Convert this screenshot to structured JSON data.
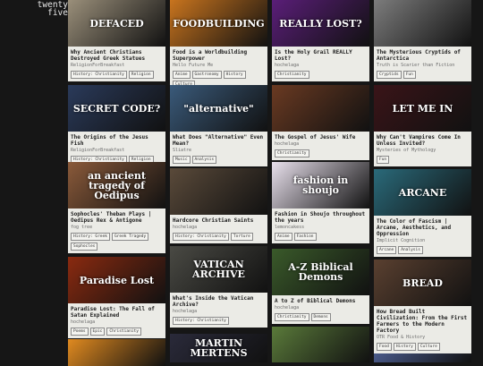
{
  "site": {
    "logo_line1": "twenty",
    "logo_line2": "five"
  },
  "cards": [
    {
      "title": "Why Ancient Christians Destroyed Greek Statues",
      "channel": "ReligionForBreakfast",
      "tags": [
        "History: Christianity",
        "Religion"
      ],
      "thumb_text": "DEFACED",
      "bg": "#9a8f7a"
    },
    {
      "title": "Food is a Worldbuilding Superpower",
      "channel": "Hello Future Me",
      "tags": [
        "Anime",
        "Gastronomy",
        "History",
        "Culture"
      ],
      "thumb_text": "FOODBUILDING",
      "bg": "#c8741e"
    },
    {
      "title": "Is the Holy Grail REALLY Lost?",
      "channel": "hochelaga",
      "tags": [
        "Christianity"
      ],
      "thumb_text": "REALLY LOST?",
      "bg": "#5a1e78"
    },
    {
      "title": "The Mysterious Cryptids of Antarctica",
      "channel": "Truth is Scarier than Fiction",
      "tags": [
        "Cryptids",
        "Fun"
      ],
      "thumb_text": "",
      "bg": "#7c7c7c"
    },
    {
      "title": "The Origins of the Jesus Fish",
      "channel": "ReligionForBreakfast",
      "tags": [
        "History: Christianity",
        "Religion"
      ],
      "thumb_text": "SECRET CODE?",
      "bg": "#2a3a5a"
    },
    {
      "title": "What Does \"Alternative\" Even Mean?",
      "channel": "Sliatre",
      "tags": [
        "Music",
        "Analysis"
      ],
      "thumb_text": "\"alternative\"",
      "bg": "#3a5a7a"
    },
    {
      "title": "The Gospel of Jesus' Wife",
      "channel": "hochelaga",
      "tags": [
        "Christianity"
      ],
      "thumb_text": "",
      "bg": "#6a3a22"
    },
    {
      "title": "Why Can't Vampires Come In Unless Invited?",
      "channel": "Mysteries of Mythology",
      "tags": [
        "Fun"
      ],
      "thumb_text": "LET ME IN",
      "bg": "#3a1418"
    },
    {
      "title": "Sophocles' Theban Plays | Oedipus Rex & Antigone",
      "channel": "fog tree",
      "tags": [
        "History: Greek",
        "Greek Tragedy",
        "Sophocles"
      ],
      "thumb_text": "an ancient tragedy of Oedipus",
      "bg": "#8a5a3a"
    },
    {
      "title": "Hardcore Christian Saints",
      "channel": "hochelaga",
      "tags": [
        "History: Christianity",
        "Torture"
      ],
      "thumb_text": "",
      "bg": "#5a4a3a"
    },
    {
      "title": "Fashion in Shoujo throughout the years",
      "channel": "lemoncakess",
      "tags": [
        "Anime",
        "Fashion"
      ],
      "thumb_text": "fashion in shoujo",
      "bg": "#e8e0ec"
    },
    {
      "title": "The Color of Fascism | Arcane, Aesthetics, and Oppression",
      "channel": "Implicit Cognition",
      "tags": [
        "Arcane",
        "Analysis"
      ],
      "thumb_text": "ARCANE",
      "bg": "#2a6a7a"
    },
    {
      "title": "Paradise Lost: The Fall of Satan Explained",
      "channel": "hochelaga",
      "tags": [
        "Poems",
        "Epic",
        "Christianity"
      ],
      "thumb_text": "Paradise Lost",
      "bg": "#8a2a10"
    },
    {
      "title": "What's Inside the Vatican Archive?",
      "channel": "hochelaga",
      "tags": [
        "History: Christianity"
      ],
      "thumb_text": "VATICAN ARCHIVE",
      "bg": "#4a4a44"
    },
    {
      "title": "A to Z of Biblical Demons",
      "channel": "hochelaga",
      "tags": [
        "Christianity",
        "Demons"
      ],
      "thumb_text": "A-Z Biblical Demons",
      "bg": "#3a5a2a"
    },
    {
      "title": "How Bread Built Civilization: From the First Farmers to the Modern Factory",
      "channel": "OTR Food & History",
      "tags": [
        "Food",
        "History",
        "Culture"
      ],
      "thumb_text": "BREAD",
      "bg": "#5a4030"
    },
    {
      "title": "",
      "channel": "",
      "tags": [],
      "thumb_text": "",
      "bg": "#e08a20"
    },
    {
      "title": "",
      "channel": "",
      "tags": [],
      "thumb_text": "MARTIN MERTENS",
      "bg": "#2a2a3a"
    },
    {
      "title": "",
      "channel": "",
      "tags": [],
      "thumb_text": "",
      "bg": "#5a7a3a"
    },
    {
      "title": "",
      "channel": "",
      "tags": [],
      "thumb_text": "",
      "bg": "#4a5a8a"
    }
  ]
}
